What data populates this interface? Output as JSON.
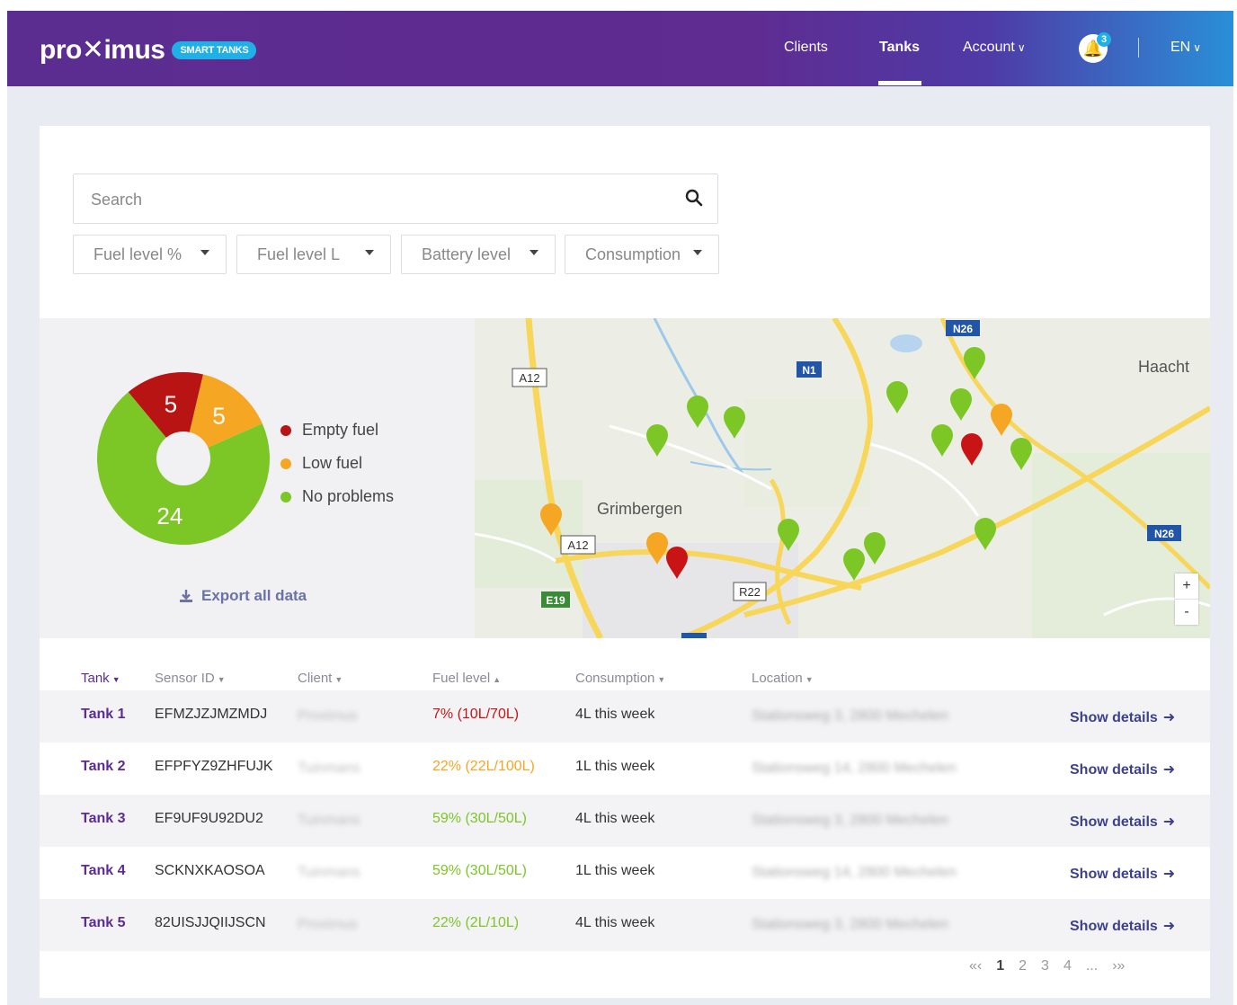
{
  "header": {
    "logo": "pro✕imus",
    "badge": "SMART TANKS",
    "nav": {
      "clients": "Clients",
      "tanks": "Tanks",
      "account": "Account",
      "notifications_count": "3",
      "language": "EN"
    }
  },
  "filters": {
    "search_placeholder": "Search",
    "items": [
      "Fuel level %",
      "Fuel level L",
      "Battery level",
      "Consumption"
    ]
  },
  "summary": {
    "pie": {
      "values": [
        5,
        5,
        24
      ],
      "labels": [
        "5",
        "5",
        "24"
      ],
      "colors": [
        "#b81414",
        "#f5a623",
        "#7cc626"
      ]
    },
    "legend": [
      "Empty fuel",
      "Low fuel",
      "No problems"
    ],
    "export_label": "Export all data"
  },
  "map": {
    "places": [
      "Grimbergen",
      "Haacht"
    ],
    "road_labels": [
      "A12",
      "N1",
      "N26",
      "A12",
      "E19",
      "R22",
      "N26"
    ],
    "zoom_in": "+",
    "zoom_out": "-"
  },
  "table": {
    "headers": [
      "Tank",
      "Sensor ID",
      "Client",
      "Fuel level",
      "Consumption",
      "Location"
    ],
    "action_label": "Show details",
    "rows": [
      {
        "tank": "Tank 1",
        "sensor": "EFMZJZJMZMDJ",
        "client": "Proximus",
        "fuel": "7% (10L/70L)",
        "fuel_status": "red",
        "consumption": "4L this week",
        "location": "Stationsweg 3, 2800 Mechelen"
      },
      {
        "tank": "Tank 2",
        "sensor": "EFPFYZ9ZHFUJK",
        "client": "Tuinmans",
        "fuel": "22% (22L/100L)",
        "fuel_status": "orange",
        "consumption": "1L this week",
        "location": "Stationsweg 14, 2800 Mechelen"
      },
      {
        "tank": "Tank 3",
        "sensor": "EF9UF9U92DU2",
        "client": "Tuinmans",
        "fuel": "59% (30L/50L)",
        "fuel_status": "green",
        "consumption": "4L this week",
        "location": "Stationsweg 3, 2800 Mechelen"
      },
      {
        "tank": "Tank 4",
        "sensor": "SCKNXKAOSOA",
        "client": "Tuinmans",
        "fuel": "59% (30L/50L)",
        "fuel_status": "green",
        "consumption": "1L this week",
        "location": "Stationsweg 14, 2800 Mechelen"
      },
      {
        "tank": "Tank 5",
        "sensor": "82UISJJQIIJSCN",
        "client": "Proximus",
        "fuel": "22% (2L/10L)",
        "fuel_status": "green",
        "consumption": "4L this week",
        "location": "Stationsweg 3, 2800 Mechelen"
      }
    ]
  },
  "pagination": [
    "«‹",
    "1",
    "2",
    "3",
    "4",
    "...",
    "›»"
  ]
}
